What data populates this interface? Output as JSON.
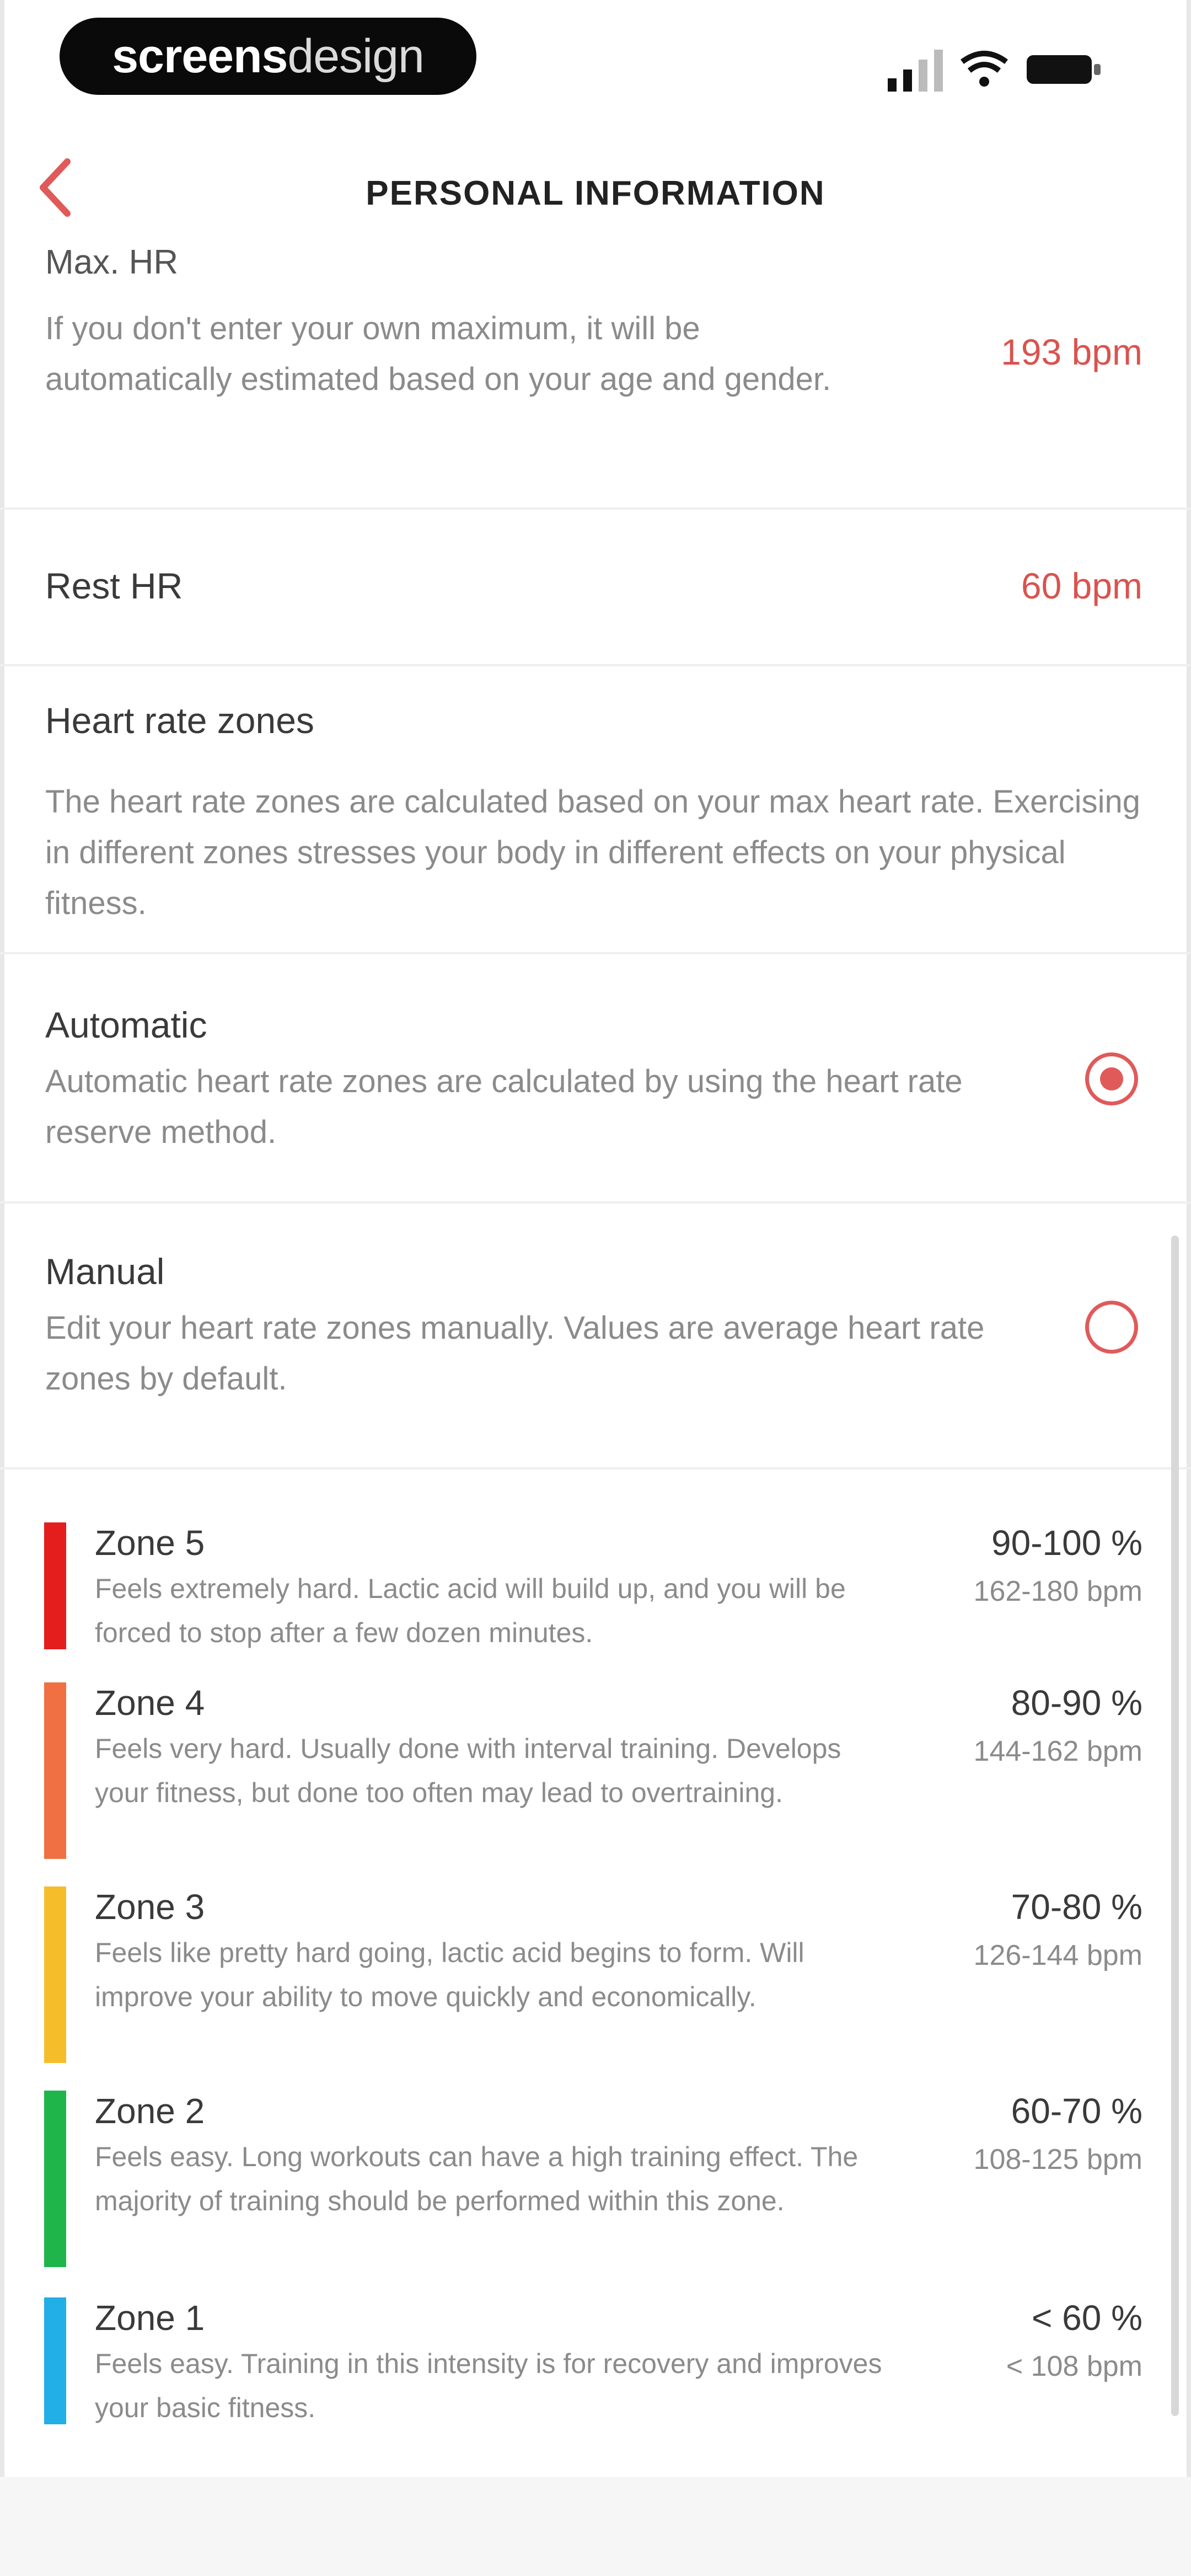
{
  "status_bar": {
    "brand_bold": "screens",
    "brand_light": "design"
  },
  "nav": {
    "title": "PERSONAL INFORMATION",
    "back_icon": "chevron-left-icon"
  },
  "max_hr": {
    "label": "Max. HR",
    "description": "If you don't enter your own maximum, it will be automatically estimated based on your age and gender.",
    "value": "193 bpm"
  },
  "rest_hr": {
    "label": "Rest HR",
    "value": "60 bpm"
  },
  "hr_zones": {
    "title": "Heart rate zones",
    "description": "The heart rate zones are calculated based on your max heart rate. Exercising in different zones stresses your body in different effects on your physical fitness."
  },
  "options": [
    {
      "title": "Automatic",
      "description": "Automatic heart rate zones are calculated by using the heart rate reserve method.",
      "selected": true
    },
    {
      "title": "Manual",
      "description": "Edit your heart rate zones manually. Values are average heart rate zones by default.",
      "selected": false
    }
  ],
  "zones": [
    {
      "name": "Zone 5",
      "description": "Feels extremely hard. Lactic acid will build up, and you will be forced to stop after a few dozen minutes.",
      "percent": "90-100 %",
      "bpm": "162-180 bpm",
      "color": "#e41d1d"
    },
    {
      "name": "Zone 4",
      "description": "Feels very hard. Usually done with interval training. Develops your fitness, but done too often may lead to overtraining.",
      "percent": "80-90 %",
      "bpm": "144-162 bpm",
      "color": "#f07043"
    },
    {
      "name": "Zone 3",
      "description": "Feels like pretty hard going, lactic acid begins to form. Will improve your ability to move quickly and economically.",
      "percent": "70-80 %",
      "bpm": "126-144 bpm",
      "color": "#f6bd2b"
    },
    {
      "name": "Zone 2",
      "description": "Feels easy. Long workouts can have a high training effect. The majority of training should be performed within this zone.",
      "percent": "60-70 %",
      "bpm": "108-125 bpm",
      "color": "#1fb54b"
    },
    {
      "name": "Zone 1",
      "description": "Feels easy. Training in this intensity is for recovery and improves your basic fitness.",
      "percent": "< 60 %",
      "bpm": "< 108 bpm",
      "color": "#22aee6"
    }
  ],
  "colors": {
    "accent": "#e05a5a",
    "value_text": "#d9534f"
  }
}
